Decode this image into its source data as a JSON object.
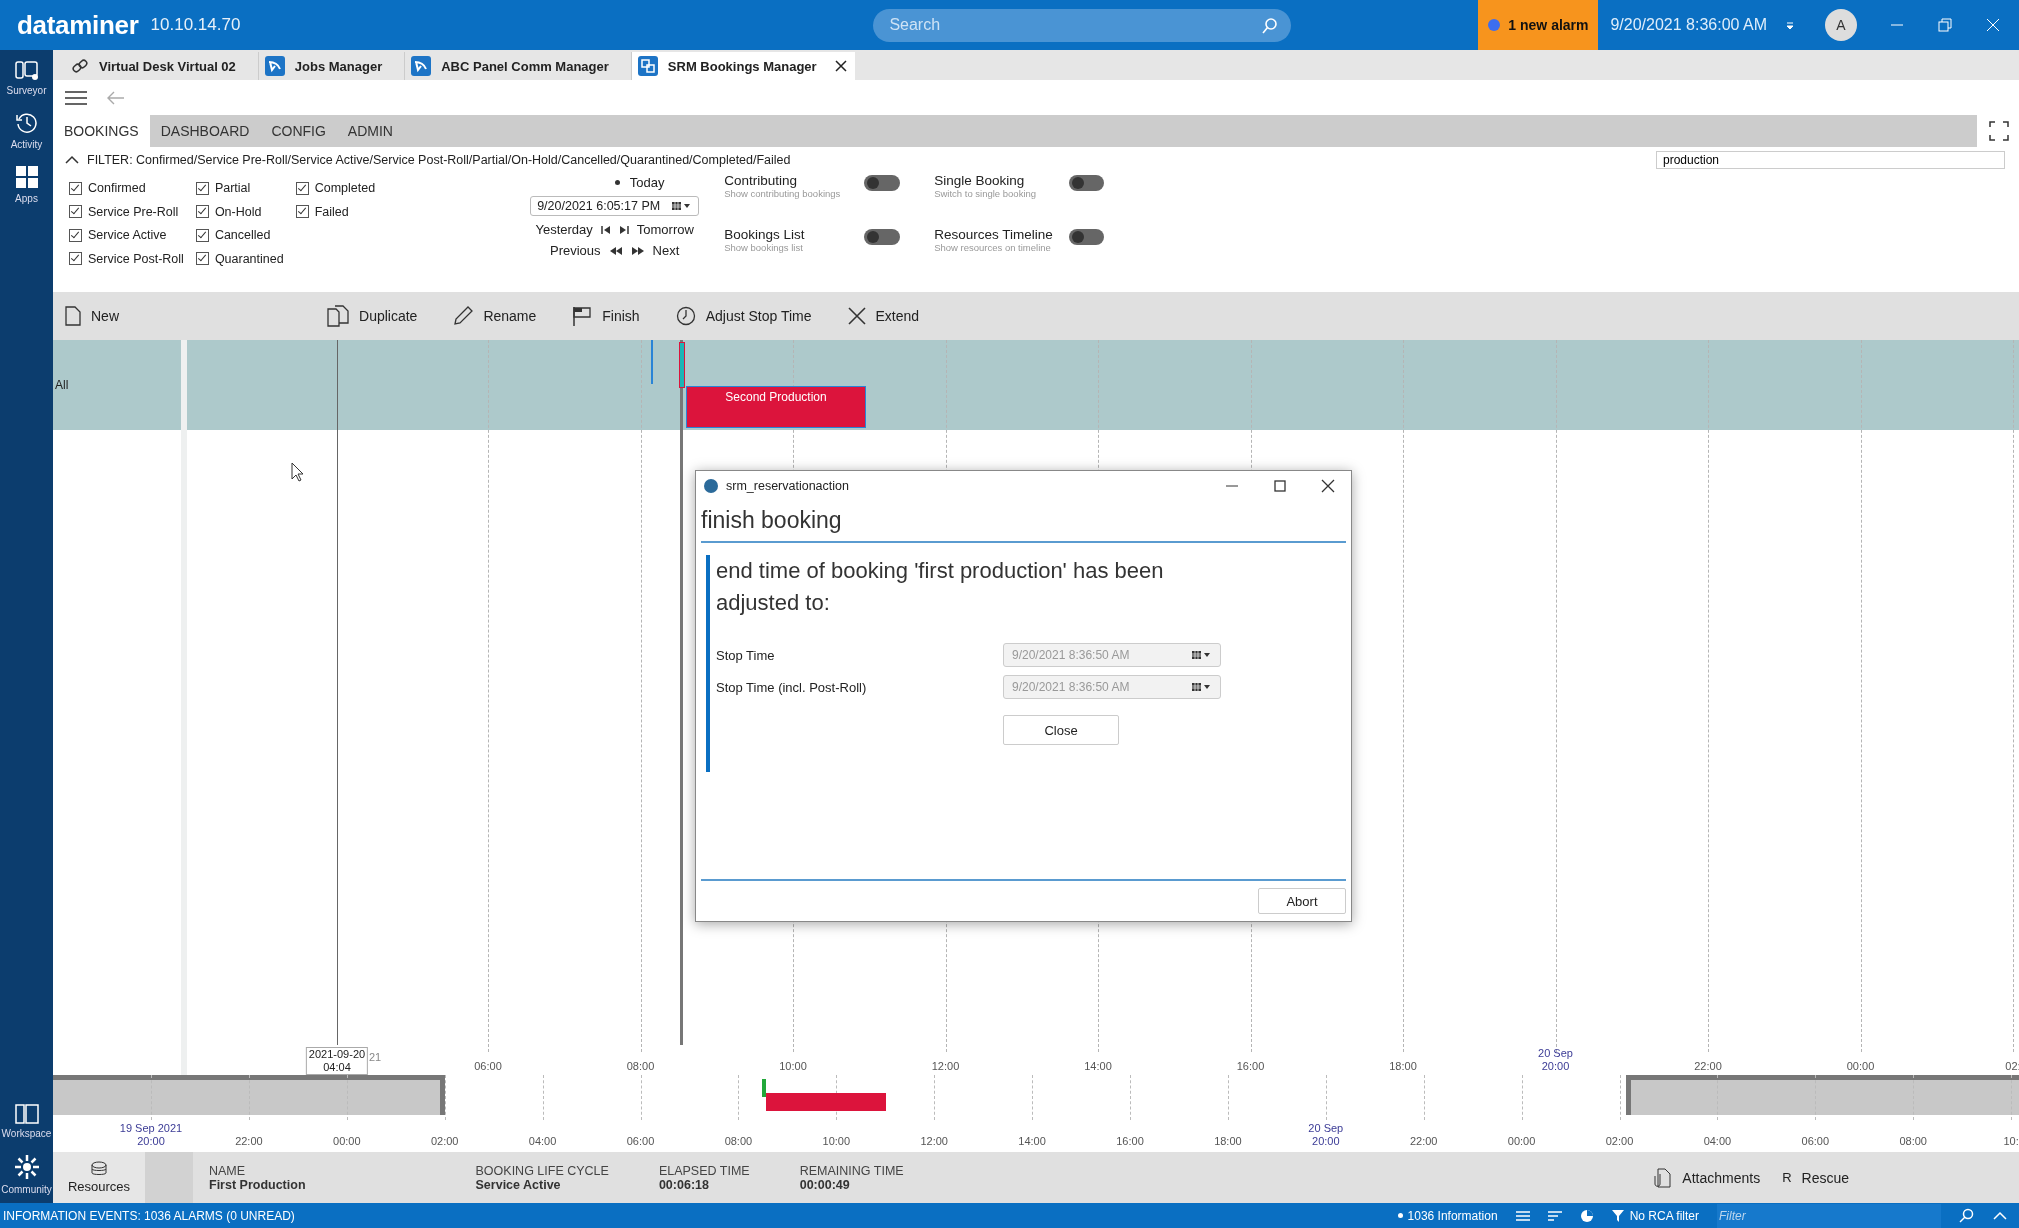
{
  "app": {
    "logo": "dataminer",
    "version": "10.10.14.70",
    "search": {
      "placeholder": "Search"
    },
    "alarm": "1 new alarm",
    "datetime": "9/20/2021 8:36:00 AM",
    "avatar": "A"
  },
  "sidebar": {
    "top": [
      {
        "label": "Surveyor",
        "kind": "surveyor"
      },
      {
        "label": "Activity",
        "kind": "activity"
      },
      {
        "label": "Apps",
        "kind": "apps"
      }
    ],
    "bottom": [
      {
        "label": "Workspace",
        "kind": "workspace"
      },
      {
        "label": "Community",
        "kind": "community"
      }
    ]
  },
  "tabs": [
    {
      "label": "Virtual Desk Virtual 02",
      "kind": "link",
      "selected": false
    },
    {
      "label": "Jobs Manager",
      "kind": "app",
      "selected": false
    },
    {
      "label": "ABC Panel Comm Manager",
      "kind": "app",
      "selected": false
    },
    {
      "label": "SRM Bookings Manager",
      "kind": "srm",
      "selected": true
    }
  ],
  "nav_tabs": [
    {
      "label": "BOOKINGS",
      "selected": true
    },
    {
      "label": "DASHBOARD",
      "selected": false
    },
    {
      "label": "CONFIG",
      "selected": false
    },
    {
      "label": "ADMIN",
      "selected": false
    }
  ],
  "filter": {
    "expanded": true,
    "text": "FILTER: Confirmed/Service Pre-Roll/Service Active/Service Post-Roll/Partial/On-Hold/Cancelled/Quarantined/Completed/Failed",
    "search_value": "production"
  },
  "status_columns": [
    {
      "items": [
        {
          "label": "Confirmed",
          "checked": true
        },
        {
          "label": "Service Pre-Roll",
          "checked": true
        },
        {
          "label": "Service Active",
          "checked": true
        },
        {
          "label": "Service Post-Roll",
          "checked": true
        }
      ]
    },
    {
      "items": [
        {
          "label": "Partial",
          "checked": true
        },
        {
          "label": "On-Hold",
          "checked": true
        },
        {
          "label": "Cancelled",
          "checked": true
        },
        {
          "label": "Quarantined",
          "checked": true
        }
      ]
    },
    {
      "items": [
        {
          "label": "Completed",
          "checked": true
        },
        {
          "label": "Failed",
          "checked": true
        }
      ]
    }
  ],
  "date_nav": {
    "today": "Today",
    "date": "9/20/2021 6:05:17 PM",
    "yesterday": "Yesterday",
    "tomorrow": "Tomorrow",
    "previous": "Previous",
    "next": "Next"
  },
  "toggles": [
    {
      "label": "Contributing",
      "hint": "Show contributing bookings",
      "on": false
    },
    {
      "label": "Single Booking",
      "hint": "Switch to single booking",
      "on": false
    },
    {
      "label": "Bookings List",
      "hint": "Show bookings list",
      "on": false
    },
    {
      "label": "Resources Timeline",
      "hint": "Show resources on timeline",
      "on": false
    }
  ],
  "toolbar": [
    {
      "label": "New",
      "kind": "new"
    },
    {
      "label": "Duplicate",
      "kind": "duplicate"
    },
    {
      "label": "Rename",
      "kind": "rename"
    },
    {
      "label": "Finish",
      "kind": "finish"
    },
    {
      "label": "Adjust Stop Time",
      "kind": "adjust"
    },
    {
      "label": "Extend",
      "kind": "extend"
    }
  ],
  "timeline": {
    "row_label": "All",
    "cursor": {
      "date": "2021-09-20",
      "time": "04:04",
      "tail": "21"
    },
    "ticks": [
      {
        "label": "06:00"
      },
      {
        "label": "08:00"
      },
      {
        "label": "10:00"
      },
      {
        "label": "12:00"
      },
      {
        "label": "14:00"
      },
      {
        "label": "16:00"
      },
      {
        "label": "18:00"
      },
      {
        "date": "20 Sep",
        "label": "20:00"
      },
      {
        "label": "22:00"
      },
      {
        "label": "00:00"
      },
      {
        "label": "02:"
      }
    ],
    "bookings": [
      {
        "label": "Second Production"
      }
    ]
  },
  "overview": {
    "ticks": [
      {
        "date": "19 Sep 2021",
        "label": "20:00"
      },
      {
        "label": "22:00"
      },
      {
        "label": "00:00"
      },
      {
        "label": "02:00"
      },
      {
        "label": "04:00"
      },
      {
        "label": "06:00"
      },
      {
        "label": "08:00"
      },
      {
        "label": "10:00"
      },
      {
        "label": "12:00"
      },
      {
        "label": "14:00"
      },
      {
        "label": "16:00"
      },
      {
        "label": "18:00"
      },
      {
        "date": "20 Sep",
        "label": "20:00"
      },
      {
        "label": "22:00"
      },
      {
        "label": "00:00"
      },
      {
        "label": "02:00"
      },
      {
        "label": "04:00"
      },
      {
        "label": "06:00"
      },
      {
        "label": "08:00"
      },
      {
        "label": "10:"
      }
    ]
  },
  "dialog": {
    "title": "srm_reservationaction",
    "heading": "finish booking",
    "message": "end time of booking 'first production' has been adjusted to:",
    "fields": [
      {
        "label": "Stop Time",
        "value": "9/20/2021 8:36:50 AM",
        "disabled": true
      },
      {
        "label": "Stop Time (incl. Post-Roll)",
        "value": "9/20/2021 8:36:50 AM",
        "disabled": true
      }
    ],
    "close": "Close",
    "abort": "Abort"
  },
  "info": {
    "resources": "Resources",
    "fields": [
      {
        "label": "NAME",
        "value": "First Production"
      },
      {
        "label": "BOOKING LIFE CYCLE",
        "value": "Service Active"
      },
      {
        "label": "ELAPSED TIME",
        "value": "00:06:18"
      },
      {
        "label": "REMAINING TIME",
        "value": "00:00:49"
      }
    ],
    "attachments": "Attachments",
    "rescue_key": "R",
    "rescue": "Rescue"
  },
  "status_bar": {
    "events": "INFORMATION EVENTS: 1036 ALARMS (0 UNREAD)",
    "info": "1036 Information",
    "rca": "No RCA filter",
    "filter_placeholder": "Filter"
  }
}
